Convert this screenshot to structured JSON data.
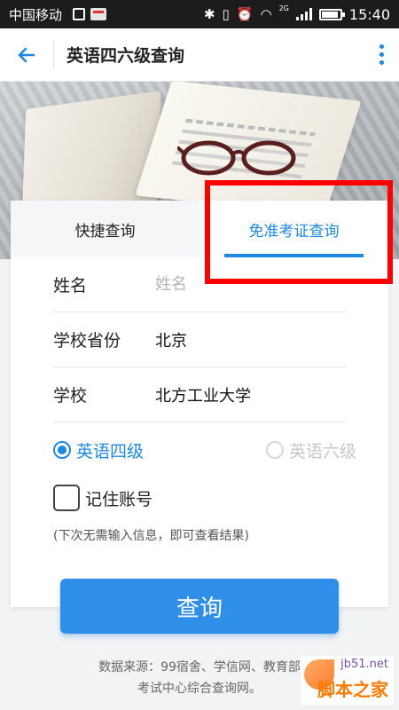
{
  "status_bar": {
    "carrier": "中国移动",
    "network_label": "2G",
    "time": "15:40"
  },
  "header": {
    "title": "英语四六级查询"
  },
  "tabs": [
    {
      "label": "快捷查询"
    },
    {
      "label": "免准考证查询"
    }
  ],
  "form": {
    "name_label": "姓名",
    "name_placeholder": "姓名",
    "province_label": "学校省份",
    "province_value": "北京",
    "school_label": "学校",
    "school_value": "北方工业大学"
  },
  "levels": {
    "cet4": "英语四级",
    "cet6": "英语六级",
    "selected": "cet4"
  },
  "remember": {
    "label": "记住账号",
    "checked": false,
    "hint": "(下次无需输入信息，即可查看结果)"
  },
  "query_button": "查询",
  "footer": {
    "line1": "数据来源：99宿舍、学信网、教育部",
    "line2": "考试中心综合查询网。"
  },
  "watermark": {
    "url": "jb51.net",
    "name": "脚本之家"
  },
  "colors": {
    "accent": "#1e88e5",
    "highlight_box": "#ff0000"
  }
}
